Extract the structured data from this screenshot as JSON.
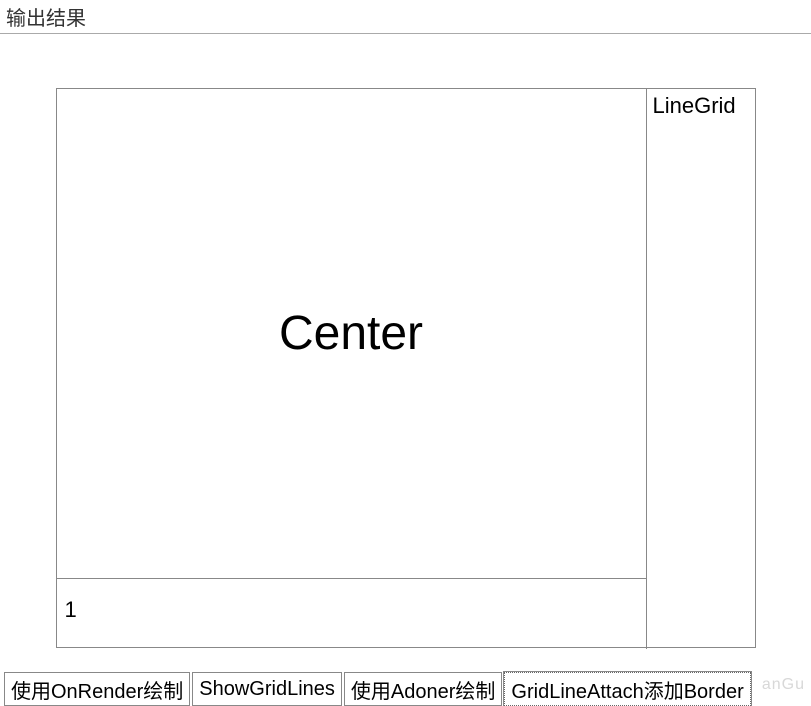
{
  "header": {
    "title": "输出结果"
  },
  "grid": {
    "center_label": "Center",
    "right_label": "LineGrid",
    "bottom_label": "1"
  },
  "tabs": [
    {
      "label": "使用OnRender绘制",
      "selected": false
    },
    {
      "label": "ShowGridLines",
      "selected": false
    },
    {
      "label": "使用Adoner绘制",
      "selected": false
    },
    {
      "label": "GridLineAttach添加Border",
      "selected": true
    }
  ],
  "watermark": "anGu"
}
